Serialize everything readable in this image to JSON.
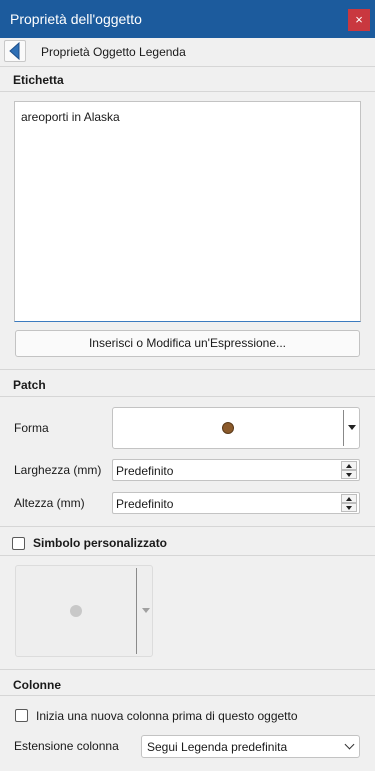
{
  "window": {
    "title": "Proprietà dell'oggetto",
    "close_glyph": "×"
  },
  "nav": {
    "back_icon": "back-arrow-icon",
    "title": "Proprietà Oggetto Legenda"
  },
  "label_section": {
    "title": "Etichetta",
    "text_value": "areoporti in Alaska",
    "expression_button": "Inserisci o Modifica un'Espressione..."
  },
  "patch_section": {
    "title": "Patch",
    "shape_label": "Forma",
    "shape_symbol_color": "#8b5a2b",
    "width_label": "Larghezza (mm)",
    "width_value": "Predefinito",
    "height_label": "Altezza (mm)",
    "height_value": "Predefinito"
  },
  "symbol_section": {
    "title": "Simbolo personalizzato",
    "checked": false
  },
  "columns_section": {
    "title": "Colonne",
    "new_column_label": "Inizia una nuova colonna prima di questo oggetto",
    "new_column_checked": false,
    "extension_label": "Estensione colonna",
    "extension_value": "Segui Legenda predefinita"
  },
  "colors": {
    "titlebar": "#1c5b9d",
    "close": "#c9383f",
    "accent": "#3b7bbf"
  }
}
